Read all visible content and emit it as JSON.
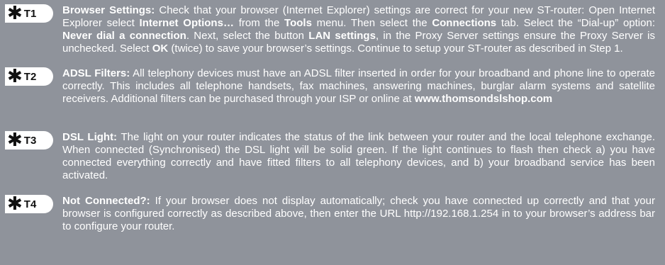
{
  "tips": [
    {
      "code": "T1",
      "segments": [
        {
          "t": "Browser Settings:",
          "b": true
        },
        {
          "t": " Check that your browser (Internet Explorer) settings are correct for your new ST-router: Open Internet Explorer select ",
          "b": false
        },
        {
          "t": "Internet Options…",
          "b": true
        },
        {
          "t": " from the ",
          "b": false
        },
        {
          "t": "Tools",
          "b": true
        },
        {
          "t": " menu. Then select the ",
          "b": false
        },
        {
          "t": "Connections",
          "b": true
        },
        {
          "t": " tab. Select the “Dial-up” option: ",
          "b": false
        },
        {
          "t": "Never dial a connection",
          "b": true
        },
        {
          "t": ". Next, select the button ",
          "b": false
        },
        {
          "t": "LAN settings",
          "b": true
        },
        {
          "t": ", in the Proxy Server settings ensure the Proxy Server is unchecked. Select ",
          "b": false
        },
        {
          "t": "OK",
          "b": true
        },
        {
          "t": " (twice) to save your browser’s settings. Continue to setup your ST-router as described in Step 1.",
          "b": false
        }
      ]
    },
    {
      "code": "T2",
      "segments": [
        {
          "t": "ADSL Filters:",
          "b": true
        },
        {
          "t": " All telephony devices must have an ADSL filter inserted in order for your broadband and phone line to operate correctly. This includes all telephone handsets, fax machines, answering machines, burglar alarm systems and satellite receivers. Additional filters can be purchased through your ISP or online at ",
          "b": false
        },
        {
          "t": "www.thomsondslshop.com",
          "b": true
        }
      ]
    },
    {
      "code": "T3",
      "segments": [
        {
          "t": "DSL Light:",
          "b": true
        },
        {
          "t": " The light on your router indicates the status of the link between your router and the local telephone exchange. When connected (Synchronised) the DSL light will be solid green. If the light continues to flash then check a) you have connected everything correctly and have fitted filters to all telephony devices, and b) your broadband service has been activated.",
          "b": false
        }
      ]
    },
    {
      "code": "T4",
      "segments": [
        {
          "t": "Not Connected?:",
          "b": true
        },
        {
          "t": " If your browser does not display automatically; check you have connected up correctly and that your browser is configured correctly as described above, then enter the URL http://192.168.1.254 in to your browser’s address bar to configure your router.",
          "b": false
        }
      ]
    }
  ],
  "star_icon": "star-icon"
}
